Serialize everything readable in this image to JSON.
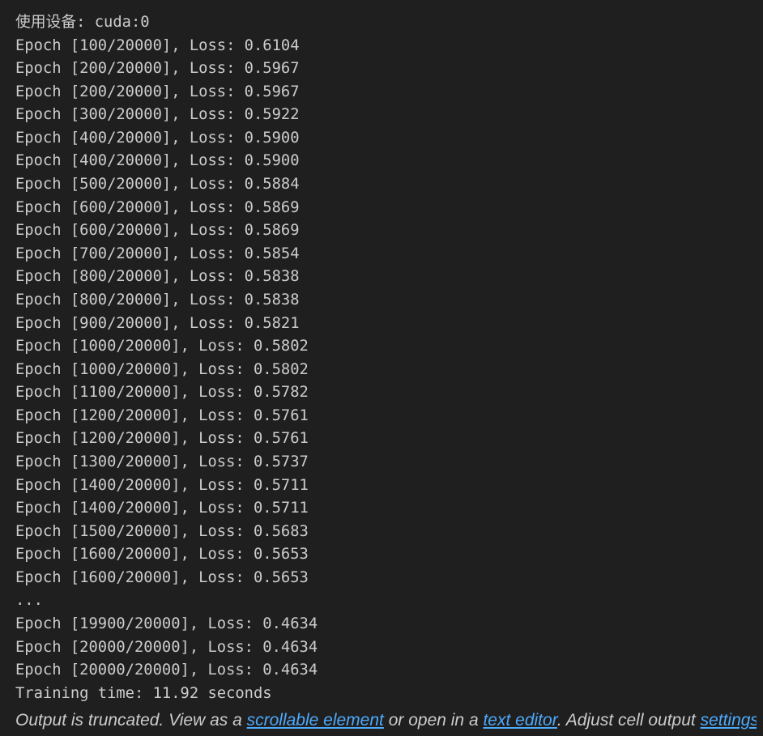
{
  "output": {
    "lines": [
      "使用设备: cuda:0",
      "Epoch [100/20000], Loss: 0.6104",
      "Epoch [200/20000], Loss: 0.5967",
      "Epoch [200/20000], Loss: 0.5967",
      "Epoch [300/20000], Loss: 0.5922",
      "Epoch [400/20000], Loss: 0.5900",
      "Epoch [400/20000], Loss: 0.5900",
      "Epoch [500/20000], Loss: 0.5884",
      "Epoch [600/20000], Loss: 0.5869",
      "Epoch [600/20000], Loss: 0.5869",
      "Epoch [700/20000], Loss: 0.5854",
      "Epoch [800/20000], Loss: 0.5838",
      "Epoch [800/20000], Loss: 0.5838",
      "Epoch [900/20000], Loss: 0.5821",
      "Epoch [1000/20000], Loss: 0.5802",
      "Epoch [1000/20000], Loss: 0.5802",
      "Epoch [1100/20000], Loss: 0.5782",
      "Epoch [1200/20000], Loss: 0.5761",
      "Epoch [1200/20000], Loss: 0.5761",
      "Epoch [1300/20000], Loss: 0.5737",
      "Epoch [1400/20000], Loss: 0.5711",
      "Epoch [1400/20000], Loss: 0.5711",
      "Epoch [1500/20000], Loss: 0.5683",
      "Epoch [1600/20000], Loss: 0.5653",
      "Epoch [1600/20000], Loss: 0.5653",
      "...",
      "Epoch [19900/20000], Loss: 0.4634",
      "Epoch [20000/20000], Loss: 0.4634",
      "Epoch [20000/20000], Loss: 0.4634",
      "Training time: 11.92 seconds"
    ]
  },
  "truncation": {
    "prefix": "Output is truncated. View as a ",
    "scrollable_link": "scrollable element",
    "middle": " or open in a ",
    "editor_link": "text editor",
    "suffix": ". Adjust cell output ",
    "settings_link": "settings",
    "ellipsis": "..."
  },
  "colors": {
    "background": "#1f1f1f",
    "text": "#cccccc",
    "link": "#4daafc"
  }
}
